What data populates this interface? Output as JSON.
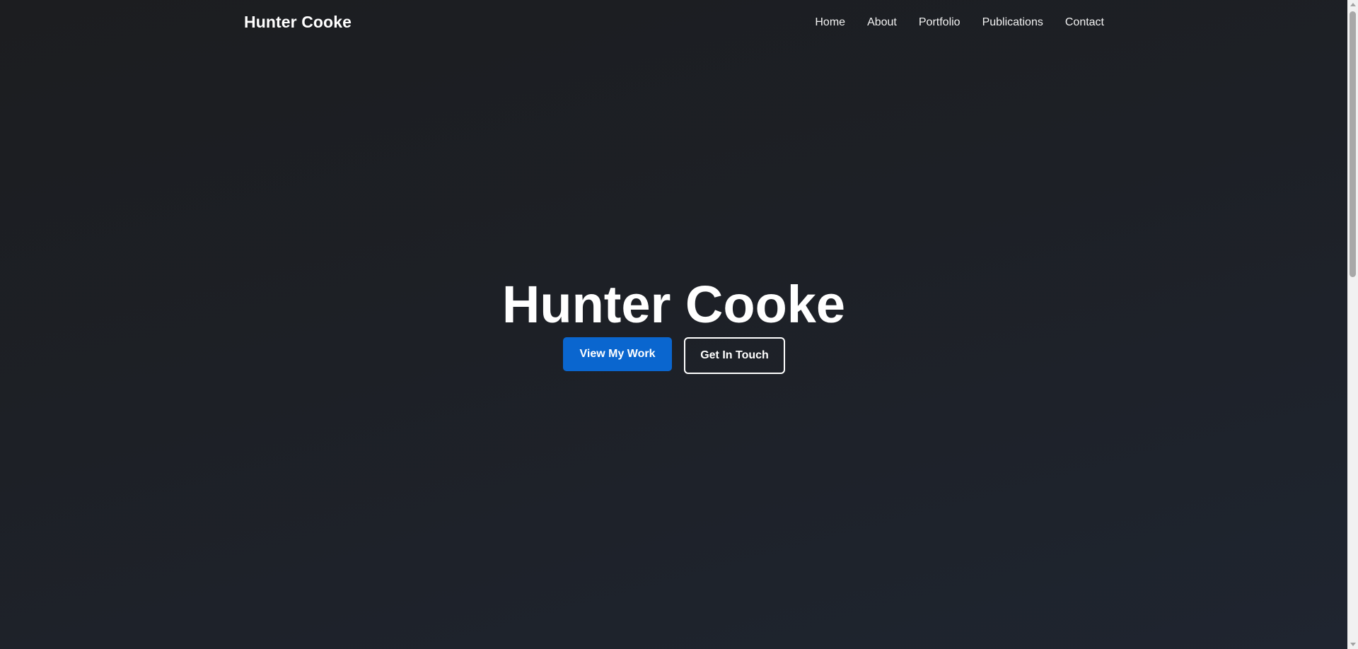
{
  "header": {
    "brand": "Hunter Cooke",
    "nav": [
      {
        "label": "Home"
      },
      {
        "label": "About"
      },
      {
        "label": "Portfolio"
      },
      {
        "label": "Publications"
      },
      {
        "label": "Contact"
      }
    ]
  },
  "hero": {
    "title": "Hunter Cooke",
    "primary_button": "View My Work",
    "secondary_button": "Get In Touch"
  },
  "colors": {
    "background": "#1d2026",
    "primary_button": "#0a66cf",
    "text": "#ffffff"
  }
}
